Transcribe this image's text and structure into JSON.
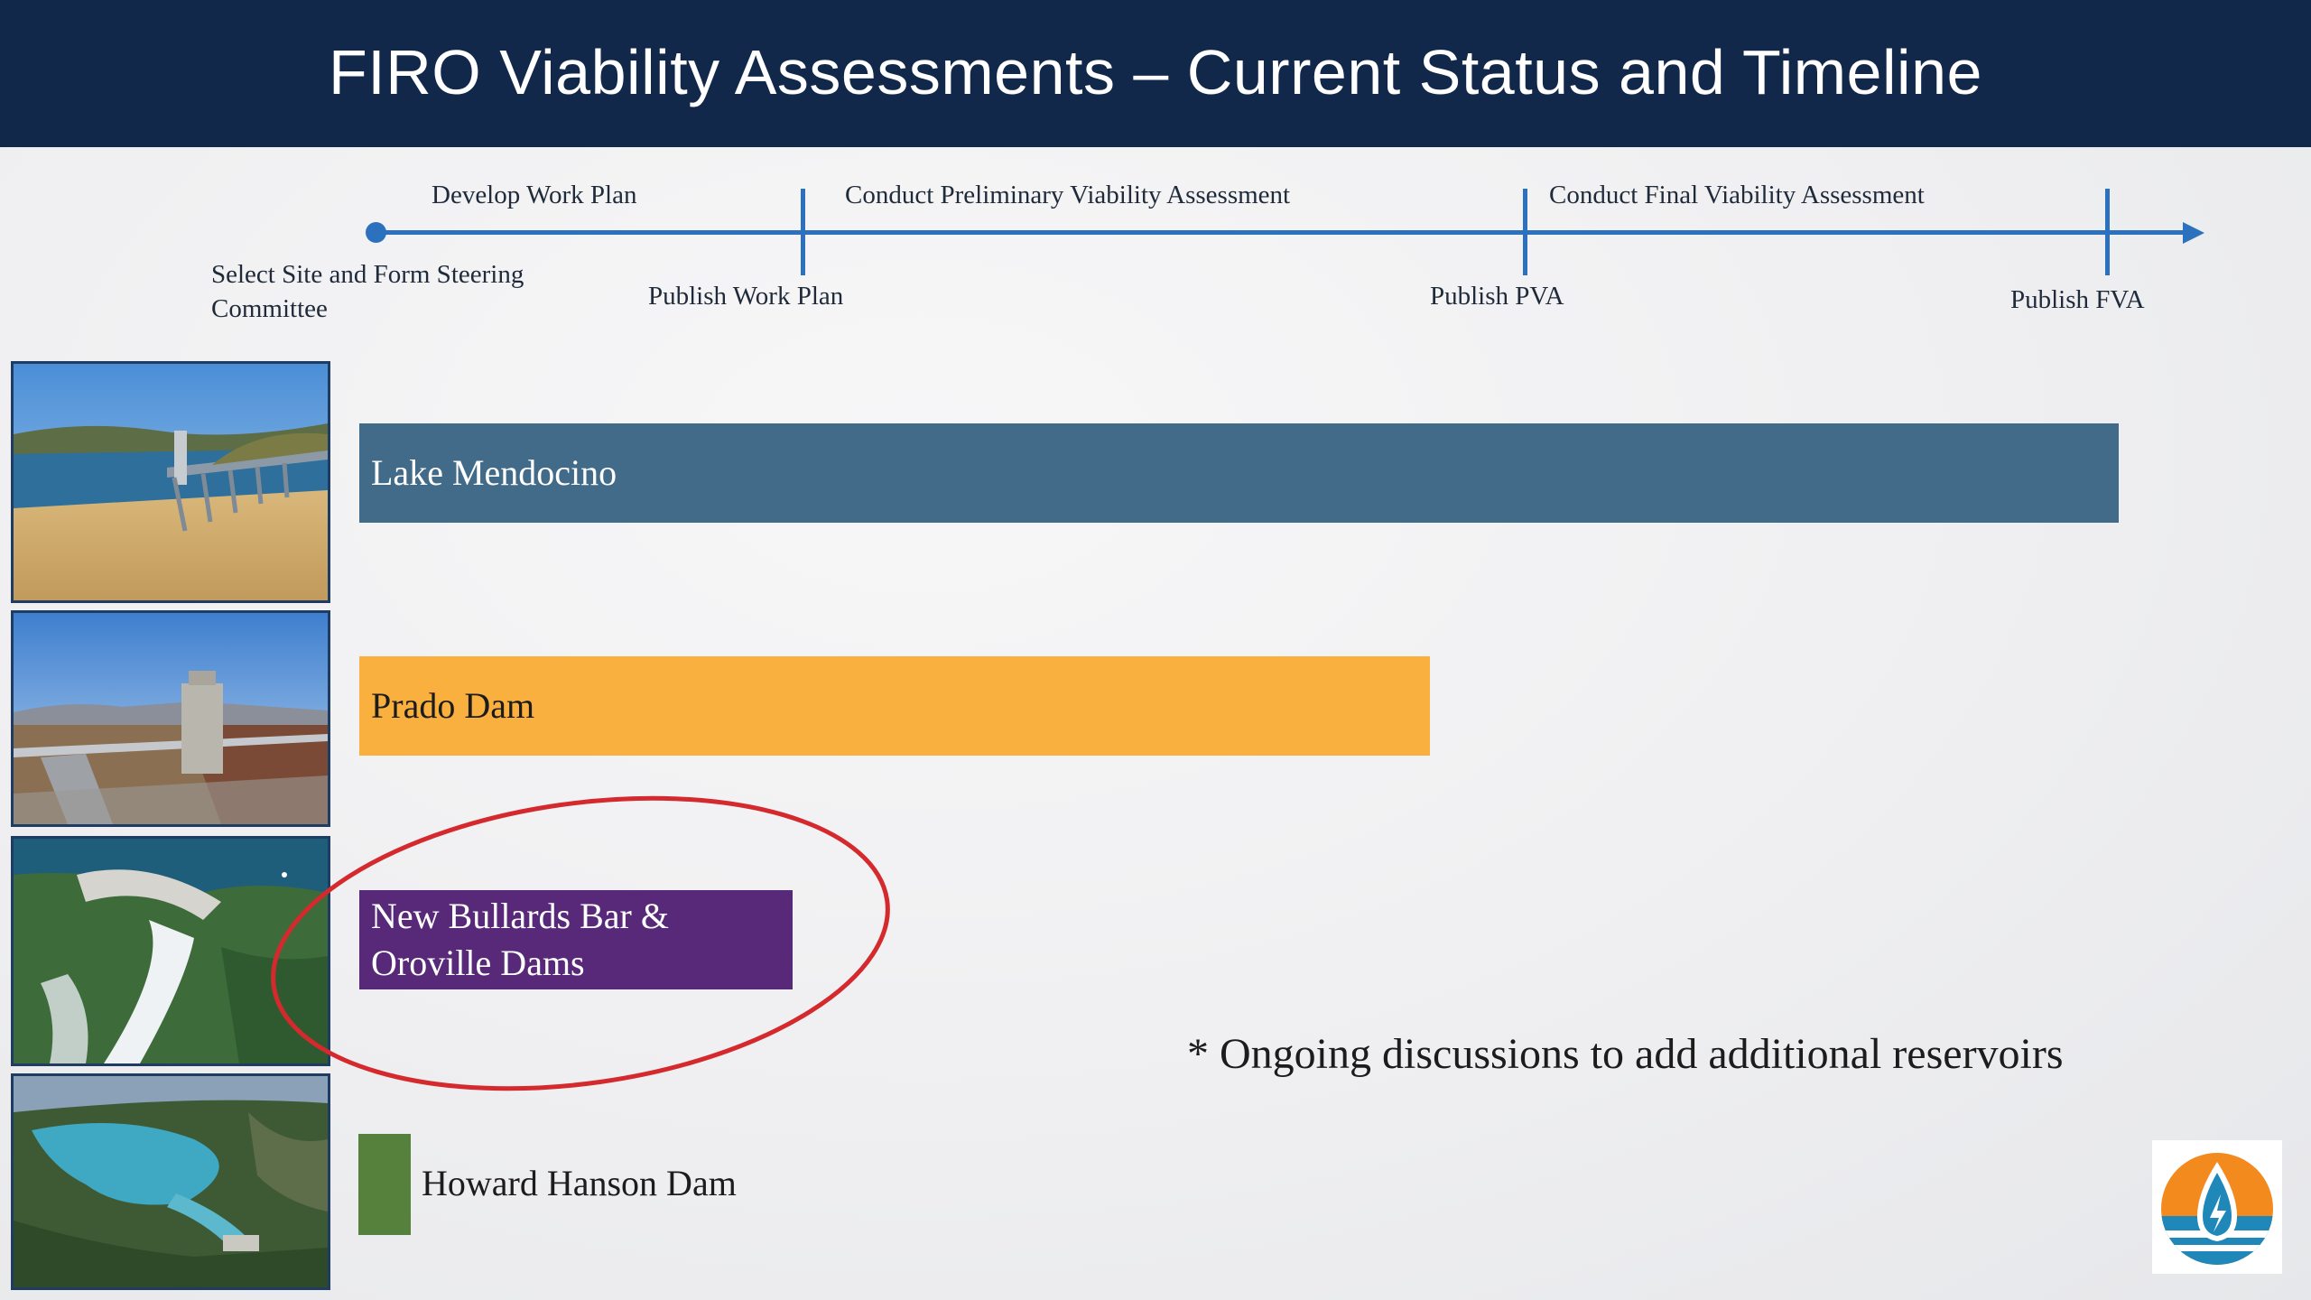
{
  "header": {
    "title": "FIRO Viability Assessments – Current Status and Timeline"
  },
  "timeline": {
    "above": [
      "Develop Work Plan",
      "Conduct Preliminary Viability Assessment",
      "Conduct Final Viability Assessment"
    ],
    "below": [
      "Select Site and Form Steering",
      "Committee",
      "Publish Work Plan",
      "Publish PVA",
      "Publish FVA"
    ]
  },
  "projects": [
    {
      "name": "Lake Mendocino",
      "color": "#426a89"
    },
    {
      "name": "Prado Dam",
      "color": "#f9b03e"
    },
    {
      "name_line1": "New Bullards Bar &",
      "name_line2": "Oroville Dams",
      "color": "#572978"
    },
    {
      "name": "Howard Hanson Dam",
      "color": "#55813c"
    }
  ],
  "note": "* Ongoing discussions to add additional reservoirs",
  "colors": {
    "header_bg": "#12284b",
    "timeline": "#2b71bd",
    "highlight_ring": "#d42a2e"
  }
}
